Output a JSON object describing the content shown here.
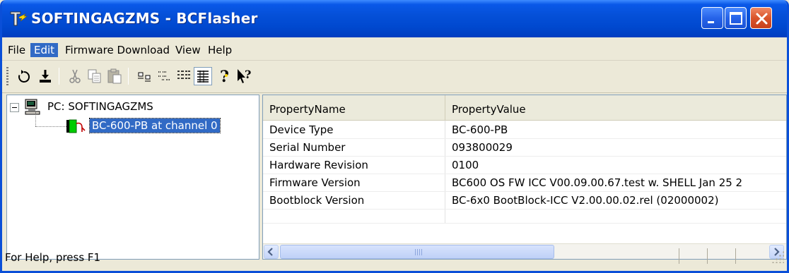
{
  "window": {
    "title": "SOFTINGAGZMS - BCFlasher",
    "controls": [
      "minimize",
      "maximize",
      "close"
    ]
  },
  "menu": {
    "items": [
      "File",
      "Edit",
      "Firmware Download",
      "View",
      "Help"
    ],
    "active": "Edit"
  },
  "toolbar": {
    "tools": [
      "refresh-icon",
      "download-icon",
      "cut-icon",
      "copy-icon",
      "paste-icon",
      "large-icons-icon",
      "small-icons-icon",
      "list-view-icon",
      "details-view-icon",
      "help-icon",
      "context-help-icon"
    ],
    "pressed": "details-view-icon"
  },
  "tree": {
    "root_label": "PC: SOFTINGAGZMS",
    "child_label": "BC-600-PB at channel 0",
    "child_icon_color": "#00CC00"
  },
  "properties": {
    "columns": [
      "PropertyName",
      "PropertyValue"
    ],
    "rows": [
      {
        "name": "Device Type",
        "value": "BC-600-PB"
      },
      {
        "name": "Serial Number",
        "value": "093800029"
      },
      {
        "name": "Hardware Revision",
        "value": "0100"
      },
      {
        "name": "Firmware Version",
        "value": "BC600 OS FW ICC V00.09.00.67.test w. SHELL Jan 25 2"
      },
      {
        "name": "Bootblock Version",
        "value": "BC-6x0 BootBlock-ICC V2.00.00.02.rel   (02000002)"
      }
    ]
  },
  "scrollbar": {
    "horizontal_position": 0
  },
  "status": {
    "text": "For Help, press F1"
  },
  "colors": {
    "titlebar": "#0550D8",
    "selection": "#316AC5",
    "close_button": "#D9542B",
    "window_face": "#ECE9D8"
  }
}
